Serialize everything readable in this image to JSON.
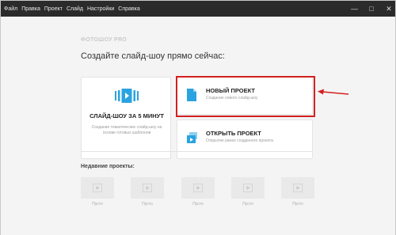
{
  "menu": [
    "Файл",
    "Правка",
    "Проект",
    "Слайд",
    "Настройки",
    "Справка"
  ],
  "window_controls": {
    "minimize": "—",
    "maximize": "□",
    "close": "✕"
  },
  "brand": "ФОТОШОУ PRO",
  "headline": "Создайте слайд-шоу прямо сейчас:",
  "quick_card": {
    "title": "СЛАЙД-ШОУ ЗА 5 МИНУТ",
    "description": "Создание тематических слайд-шоу на основе готовых шаблонов",
    "icon": "film-play-icon"
  },
  "new_project": {
    "title": "НОВЫЙ ПРОЕКТ",
    "description": "Создание нового слайд-шоу",
    "icon": "document-icon"
  },
  "open_project": {
    "title": "ОТКРЫТЬ ПРОЕКТ",
    "description": "Открытие ранее созданного проекта",
    "icon": "open-project-icon"
  },
  "recent": {
    "label": "Недавние проекты:",
    "items": [
      "Пусто",
      "Пусто",
      "Пусто",
      "Пусто",
      "Пусто"
    ]
  },
  "colors": {
    "titlebar": "#2b2b2b",
    "accent_blue": "#2aa3e0",
    "annotation_red": "#d32020"
  }
}
